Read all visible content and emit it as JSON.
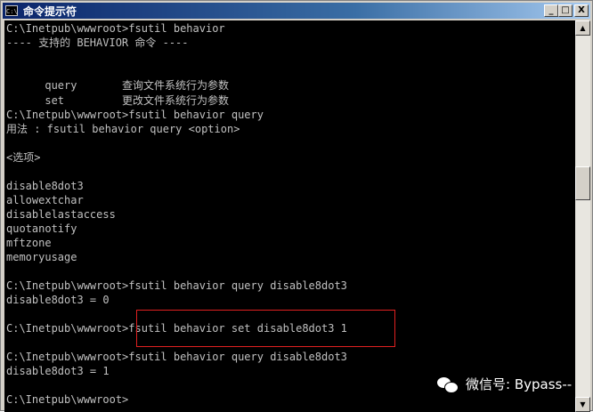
{
  "window": {
    "title": "命令提示符",
    "icon_text": "C:\\",
    "buttons": {
      "minimize": "_",
      "maximize": "□",
      "close": "X"
    }
  },
  "console": {
    "lines": [
      "C:\\Inetpub\\wwwroot>fsutil behavior",
      "---- 支持的 BEHAVIOR 命令 ----",
      "",
      "",
      "",
      "",
      "C:\\Inetpub\\wwwroot>fsutil behavior query",
      "用法 : fsutil behavior query <option>",
      "",
      "<选项>",
      "",
      "disable8dot3",
      "allowextchar",
      "disablelastaccess",
      "quotanotify",
      "mftzone",
      "memoryusage",
      "",
      "C:\\Inetpub\\wwwroot>fsutil behavior query disable8dot3",
      "disable8dot3 = 0",
      "",
      "C:\\Inetpub\\wwwroot>fsutil behavior set disable8dot3 1",
      "",
      "C:\\Inetpub\\wwwroot>fsutil behavior query disable8dot3",
      "disable8dot3 = 1",
      "",
      "C:\\Inetpub\\wwwroot>"
    ],
    "commands": [
      {
        "name": "query",
        "description": "查询文件系统行为参数"
      },
      {
        "name": "set",
        "description": "更改文件系统行为参数"
      }
    ]
  },
  "watermark": {
    "text": "微信号: Bypass--"
  },
  "colors": {
    "console_bg": "#000000",
    "console_fg": "#c0c0c0",
    "highlight": "#e02020",
    "titlebar": "#0a246a"
  }
}
